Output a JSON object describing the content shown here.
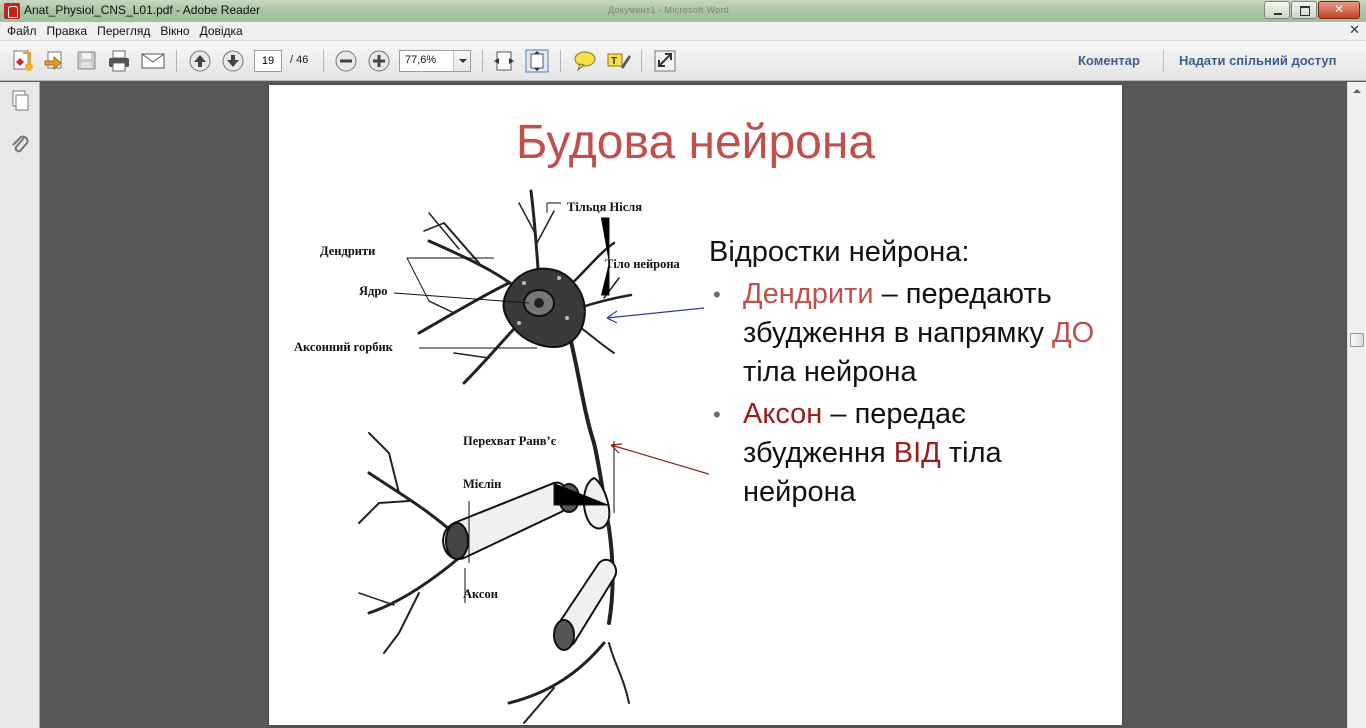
{
  "window": {
    "title": "Anat_Physiol_CNS_L01.pdf - Adobe Reader",
    "background_title": "Документ1 - Microsoft Word"
  },
  "menu": [
    "Файл",
    "Правка",
    "Перегляд",
    "Вікно",
    "Довідка"
  ],
  "toolbar": {
    "page_current": "19",
    "page_total": "/ 46",
    "zoom": "77,6%",
    "comment_link": "Коментар",
    "share_link": "Надати спільний доступ"
  },
  "slide": {
    "title": "Будова нейрона",
    "lead": "Відростки нейрона:",
    "bullet1": {
      "term": "Дендрити",
      "text_a": " – передають збудження в напрямку ",
      "emph": "ДО",
      "text_b": " тіла нейрона"
    },
    "bullet2": {
      "term": "Аксон",
      "text_a": " – передає збудження ",
      "emph": "ВІД",
      "text_b": " тіла нейрона"
    },
    "diagram_labels": {
      "nissl": "Тільця Нісля",
      "dendrites": "Дендрити",
      "body": "Тіло нейрона",
      "nucleus": "Ядро",
      "hillock": "Аксонний горбик",
      "ranvier": "Перехват Ранв’є",
      "myelin": "Мієлін",
      "axon": "Аксон"
    }
  },
  "colors": {
    "title": "#c0504d",
    "dendrite_term": "#c0504d",
    "axon_term": "#9b1c1c",
    "link": "#3d5f8d"
  }
}
